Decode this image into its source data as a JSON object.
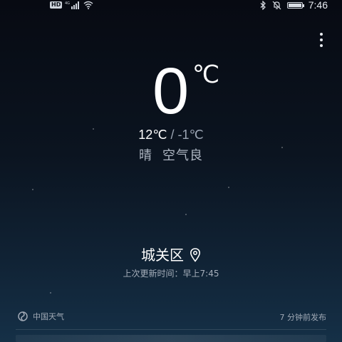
{
  "status_bar": {
    "hd_badge": "HD",
    "network_type": "4G",
    "time": "7:46",
    "battery_level": 1.0,
    "icons": [
      "signal-icon",
      "wifi-icon",
      "bluetooth-icon",
      "notifications-muted-icon",
      "battery-icon"
    ]
  },
  "weather": {
    "current_temp": "0",
    "temp_unit": "℃",
    "high": "12℃",
    "separator": "/",
    "low": "-1℃",
    "condition": "晴",
    "air_quality": "空气良"
  },
  "location": {
    "name": "城关区",
    "updated": "上次更新时间：早上7:45"
  },
  "footer": {
    "source": "中国天气",
    "published": "7 分钟前发布"
  },
  "colors": {
    "background_top": "#070a12",
    "background_bottom": "#153047",
    "primary_text": "#ffffff",
    "secondary_text": "#9aa4b2"
  }
}
